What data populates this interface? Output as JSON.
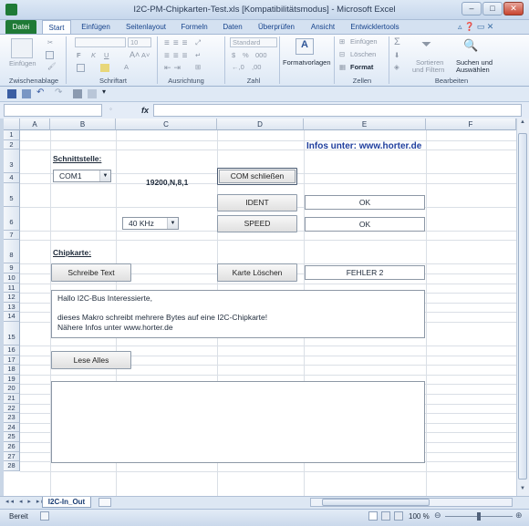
{
  "window": {
    "title": "I2C-PM-Chipkarten-Test.xls  [Kompatibilitätsmodus]  -  Microsoft Excel"
  },
  "ribbon": {
    "tabs": [
      "Datei",
      "Start",
      "Einfügen",
      "Seitenlayout",
      "Formeln",
      "Daten",
      "Überprüfen",
      "Ansicht",
      "Entwicklertools"
    ],
    "groups": {
      "clipboard": {
        "paste": "Einfügen",
        "label": "Zwischenablage"
      },
      "font": {
        "label": "Schriftart",
        "size": "10"
      },
      "alignment": {
        "label": "Ausrichtung"
      },
      "number": {
        "label": "Zahl",
        "format": "Standard",
        "percent": "%",
        "thousand": "000"
      },
      "styles": {
        "label": "Formatvorlagen"
      },
      "cells": {
        "insert": "Einfügen",
        "delete": "Löschen",
        "format": "Format",
        "label": "Zellen"
      },
      "editing": {
        "sort": "Sortieren und Filtern",
        "sort_l1": "Sortieren",
        "sort_l2": "und Filtern",
        "find": "Suchen und Auswählen",
        "find_l1": "Suchen und",
        "find_l2": "Auswählen",
        "sigma": "Σ",
        "label": "Bearbeiten"
      }
    }
  },
  "formula_bar": {
    "fx": "fx",
    "name": "",
    "content": ""
  },
  "grid": {
    "columns": [
      "A",
      "B",
      "C",
      "D",
      "E",
      "F"
    ],
    "rows": [
      "1",
      "2",
      "3",
      "4",
      "5",
      "6",
      "7",
      "8",
      "9",
      "10",
      "11",
      "12",
      "13",
      "14",
      "15",
      "16",
      "17",
      "18",
      "19",
      "20",
      "21",
      "22",
      "23",
      "24",
      "25",
      "26",
      "27",
      "28"
    ]
  },
  "sheet": {
    "info": "Infos unter: www.horter.de",
    "schnittstelle_label": "Schnittstelle:",
    "com_port": "COM1",
    "baud": "19200,N,8,1",
    "com_close_button": "COM schließen",
    "ident_button": "IDENT",
    "ident_result": "OK",
    "speed_select": "40 KHz",
    "speed_button": "SPEED",
    "speed_result": "OK",
    "chipkarte_label": "Chipkarte:",
    "write_button": "Schreibe Text",
    "clear_button": "Karte Löschen",
    "clear_result": "FEHLER 2",
    "message_text": "Hallo I2C-Bus Interessierte,\n\ndieses Makro schreibt mehrere Bytes auf eine I2C-Chipkarte!\nNähere Infos unter www.horter.de",
    "read_button": "Lese Alles",
    "read_output": ""
  },
  "sheet_tabs": {
    "active": "I2C-In_Out"
  },
  "status_bar": {
    "state": "Bereit",
    "zoom": "100 %",
    "zoom_percent": 100
  }
}
